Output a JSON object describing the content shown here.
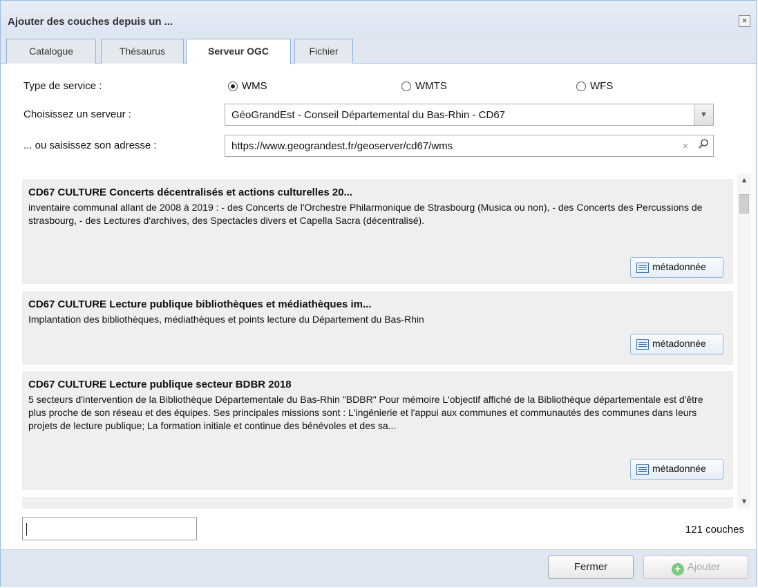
{
  "dialog": {
    "title": "Ajouter des couches depuis un ...",
    "close_symbol": "×"
  },
  "tabs": [
    {
      "label": "Catalogue"
    },
    {
      "label": "Thésaurus"
    },
    {
      "label": "Serveur OGC"
    },
    {
      "label": "Fichier"
    }
  ],
  "active_tab": "Serveur OGC",
  "service_type": {
    "label": "Type de service :",
    "options": [
      {
        "label": "WMS",
        "checked": true
      },
      {
        "label": "WMTS",
        "checked": false
      },
      {
        "label": "WFS",
        "checked": false
      }
    ]
  },
  "server_select": {
    "label": "Choisissez un serveur :",
    "value": "GéoGrandEst - Conseil Départemental du Bas-Rhin - CD67"
  },
  "server_url": {
    "label": "... ou saisissez son adresse :",
    "value": "https://www.geograndest.fr/geoserver/cd67/wms",
    "clear_symbol": "×",
    "search_icon": "search-icon"
  },
  "layers": [
    {
      "title": "CD67 CULTURE Concerts décentralisés et actions culturelles 20...",
      "description": "inventaire communal allant de 2008 à 2019 : - des Concerts de l'Orchestre Philarmonique de Strasbourg (Musica ou non), - des Concerts des Percussions de strasbourg, - des Lectures d'archives, des Spectacles divers et Capella Sacra (décentralisé).",
      "button": "métadonnée"
    },
    {
      "title": "CD67 CULTURE Lecture publique bibliothèques et médiathèques im...",
      "description": "Implantation des bibliothèques, médiathèques et points lecture du Département du Bas-Rhin",
      "button": "métadonnée"
    },
    {
      "title": "CD67 CULTURE Lecture publique secteur BDBR 2018",
      "description": "5 secteurs d'intervention de la Bibliothèque Départementale du Bas-Rhin \"BDBR\" Pour mémoire L'objectif affiché de la Bibliothèque départementale est d'être plus proche de son réseau et des équipes. Ses principales missions sont : L'ingénierie et l'appui aux communes et communautés des communes dans leurs projets de lecture publique; La formation initiale et continue des bénévoles et des sa...",
      "button": "métadonnée"
    }
  ],
  "filter": {
    "value": ""
  },
  "layer_count": "121 couches",
  "footer": {
    "close_label": "Fermer",
    "add_label": "Ajouter"
  }
}
